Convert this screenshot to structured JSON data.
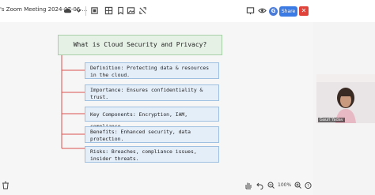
{
  "window": {
    "title": "'s Zoom Meeting 2024-07-06 ..."
  },
  "toolbar": {
    "icons": [
      "cloud-icon",
      "chevron-down-icon",
      "frame-icon",
      "grid-icon",
      "bookmark-icon",
      "image-icon",
      "adjust-icon"
    ],
    "right_icons": [
      "board-icon",
      "eye-icon"
    ],
    "avatar_initial": "G",
    "share_label": "Share",
    "close_label": "✕"
  },
  "mindmap": {
    "root": "What is Cloud Security and Privacy?",
    "children": [
      "Definition: Protecting data & resources in the cloud.",
      "Importance: Ensures confidentiality & trust.",
      "Key Components: Encryption, IAM, compliance.",
      "Benefits: Enhanced security, data protection.",
      "Risks: Breaches, compliance issues, insider threats."
    ]
  },
  "participant": {
    "name": "Gauri Yadav"
  },
  "bottom": {
    "zoom": "100%"
  },
  "colors": {
    "root_fill": "#e6f1e6",
    "root_border": "#a9cfa9",
    "child_fill": "#e4eef9",
    "child_border": "#9fc0e0",
    "connector": "#d9534f",
    "share": "#3b7be3",
    "close": "#e0433a"
  }
}
